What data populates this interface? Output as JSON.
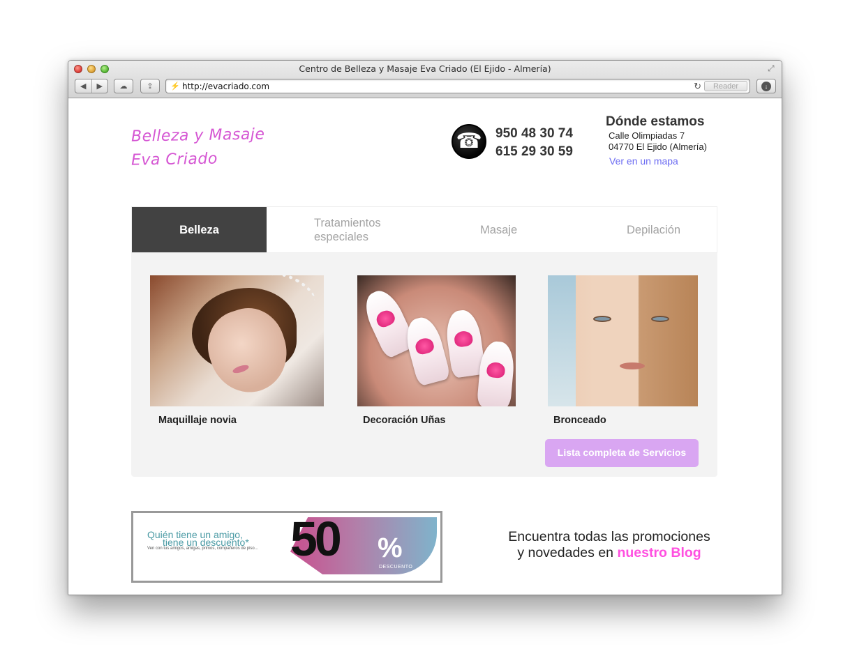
{
  "window": {
    "title": "Centro de Belleza y Masaje Eva Criado (El Ejido - Almería)",
    "url": "http://evacriado.com",
    "reader_label": "Reader"
  },
  "icons": {
    "back": "back-arrow-icon",
    "forward": "forward-arrow-icon",
    "cloud": "cloud-icon",
    "share": "share-icon",
    "reload": "reload-icon",
    "download": "download-icon",
    "phone": "telephone-icon"
  },
  "colors": {
    "logo": "#d556d3",
    "active_tab": "#424242",
    "map_link": "#6c6cf2",
    "services_button": "#d9a6f2",
    "blog_link": "#ff4fe0"
  },
  "header": {
    "logo_line1": "Belleza y Masaje",
    "logo_line2": "Eva Criado",
    "phone1": "950 48 30 74",
    "phone2": "615 29 30 59",
    "location_title": "Dónde estamos",
    "address_line1": "Calle Olimpiadas 7",
    "address_line2": "04770 El Ejido (Almería)",
    "map_link": "Ver en un mapa"
  },
  "tabs": [
    {
      "label": "Belleza",
      "active": true
    },
    {
      "label": "Tratamientos especiales",
      "active": false
    },
    {
      "label": "Masaje",
      "active": false
    },
    {
      "label": "Depilación",
      "active": false
    }
  ],
  "services": [
    {
      "caption": "Maquillaje novia"
    },
    {
      "caption": "Decoración Uñas"
    },
    {
      "caption": "Bronceado"
    }
  ],
  "services_button": "Lista completa de Servicios",
  "promo": {
    "line1": "Quién tiene un amigo,",
    "line2": "tiene un descuento*",
    "line3": "Ven con tus amigos, amigas, primos, compañeros de piso...",
    "big": "50",
    "percent": "%",
    "descuento": "DESCUENTO"
  },
  "blog": {
    "line1": "Encuentra todas las promociones",
    "line2_prefix": "y novedades en",
    "link": "nuestro Blog"
  }
}
